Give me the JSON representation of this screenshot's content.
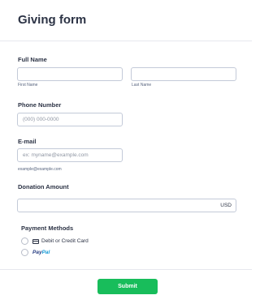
{
  "form": {
    "title": "Giving form",
    "full_name": {
      "label": "Full Name",
      "first_sublabel": "First Name",
      "last_sublabel": "Last Name",
      "first_value": "",
      "last_value": ""
    },
    "phone": {
      "label": "Phone Number",
      "placeholder": "(000) 000-0000"
    },
    "email": {
      "label": "E-mail",
      "placeholder": "ex: myname@example.com",
      "sublabel": "example@example.com"
    },
    "donation": {
      "label": "Donation Amount",
      "currency": "USD",
      "value": ""
    },
    "payment": {
      "label": "Payment Methods",
      "options": [
        {
          "label": "Debit or Credit Card",
          "icon": "credit-card-icon"
        },
        {
          "label": "PayPal",
          "icon": "paypal-logo"
        }
      ]
    },
    "submit_label": "Submit"
  },
  "colors": {
    "accent": "#18bd5b",
    "text": "#2c3345",
    "border": "#c3cad8",
    "paypal_dark": "#253b80",
    "paypal_light": "#179bd7"
  }
}
